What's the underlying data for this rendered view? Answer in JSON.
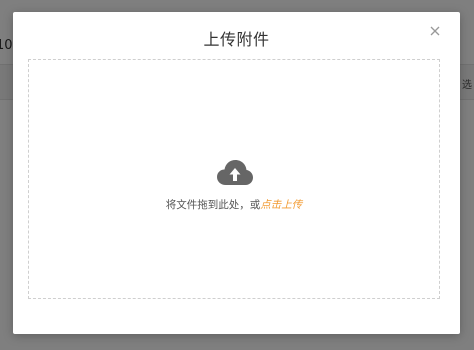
{
  "background": {
    "header_text": "10",
    "toolbar_text": "选"
  },
  "modal": {
    "title": "上传附件",
    "close_icon": "close-icon",
    "dropzone": {
      "icon": "cloud-upload-icon",
      "hint_text": "将文件拖到此处，或",
      "link_text": "点击上传",
      "link_color": "#f29b32"
    }
  }
}
